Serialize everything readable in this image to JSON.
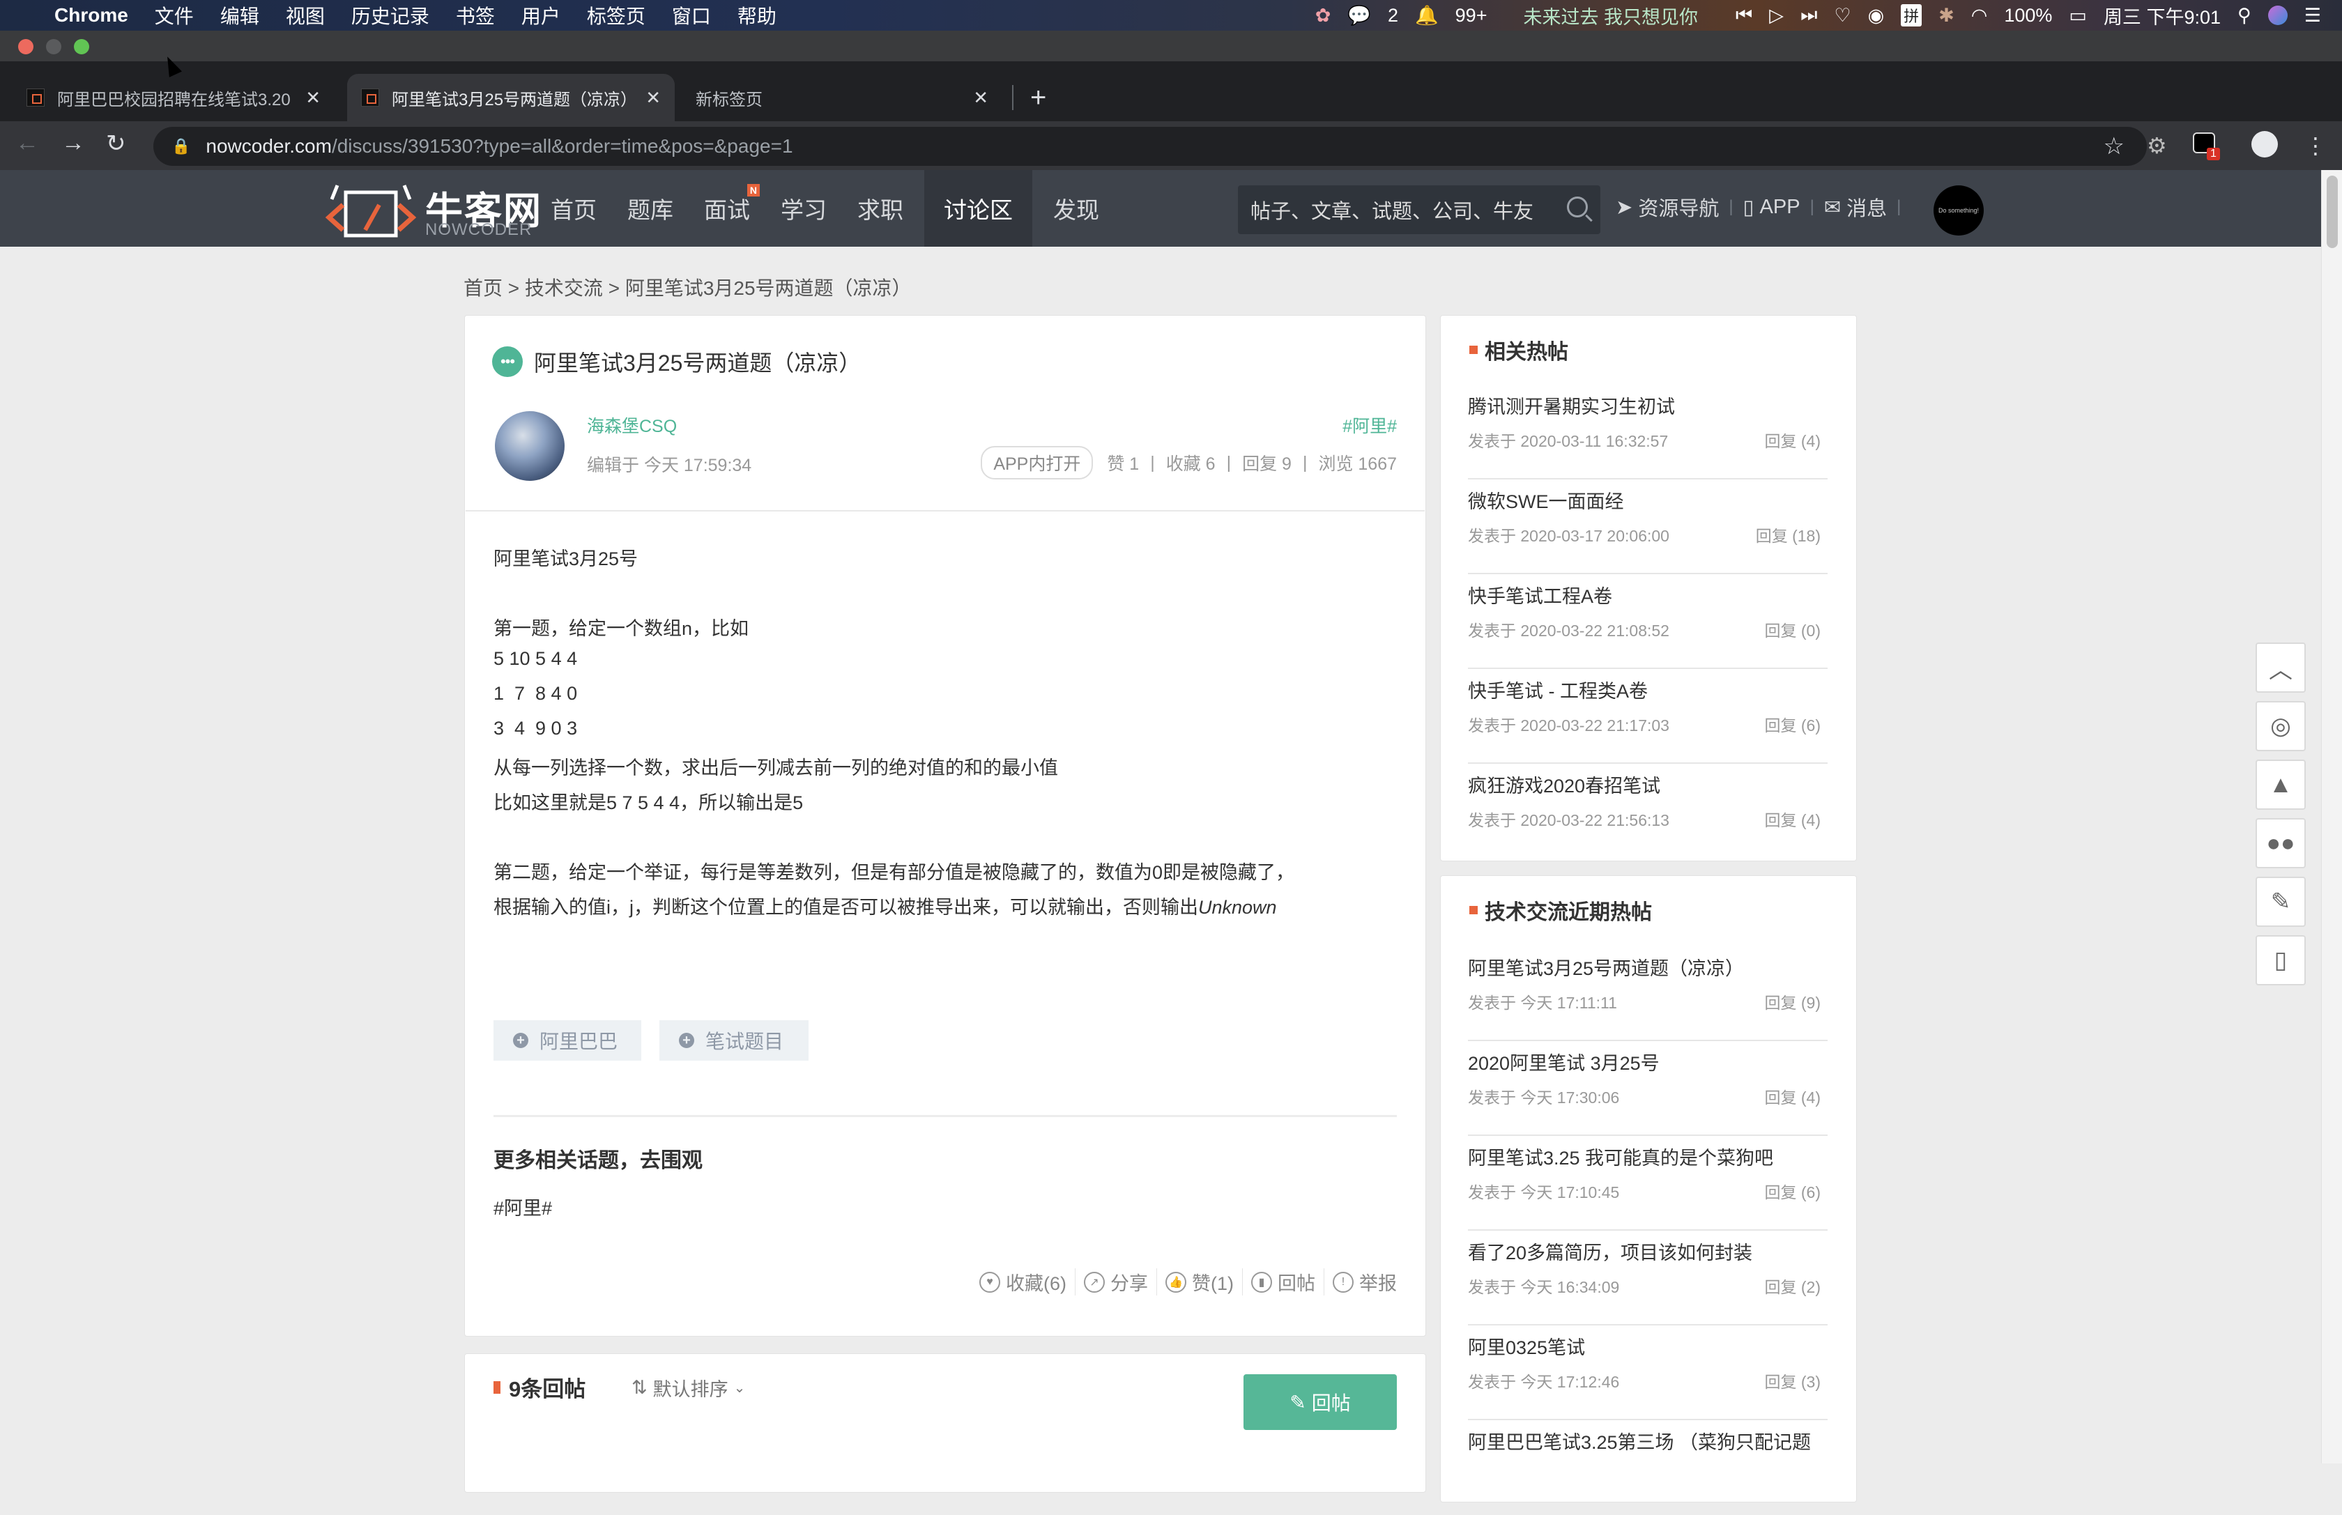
{
  "menubar": {
    "app": "Chrome",
    "items": [
      "文件",
      "编辑",
      "视图",
      "历史记录",
      "书签",
      "用户",
      "标签页",
      "窗口",
      "帮助"
    ],
    "wechat_count": "2",
    "qq_count": "99+",
    "now_playing": "未来过去 我只想见你",
    "ime": "拼",
    "battery": "100%",
    "clock": "周三 下午9:01"
  },
  "browser": {
    "tabs": [
      {
        "title": "阿里巴巴校园招聘在线笔试3.20",
        "active": false
      },
      {
        "title": "阿里笔试3月25号两道题（凉凉）",
        "active": true
      },
      {
        "title": "新标签页",
        "active": false
      }
    ],
    "url_host": "nowcoder.com",
    "url_path": "/discuss/391530?type=all&order=time&pos=&page=1",
    "extension_badge": "1"
  },
  "site": {
    "logo_cn": "牛客网",
    "logo_en": "NOWCODER",
    "nav": [
      {
        "label": "首页",
        "active": false
      },
      {
        "label": "题库",
        "active": false
      },
      {
        "label": "面试",
        "active": false,
        "badge": "N"
      },
      {
        "label": "学习",
        "active": false
      },
      {
        "label": "求职",
        "active": false
      },
      {
        "label": "讨论区",
        "active": true
      },
      {
        "label": "发现",
        "active": false
      }
    ],
    "search_placeholder": "帖子、文章、试题、公司、牛友",
    "links": {
      "resources": "资源导航",
      "app": "APP",
      "messages": "消息"
    },
    "user_avatar_text": "Do something!"
  },
  "breadcrumb": "首页 > 技术交流 > 阿里笔试3月25号两道题（凉凉）",
  "post": {
    "title": "阿里笔试3月25号两道题（凉凉）",
    "author": "海森堡CSQ",
    "edited": "编辑于 今天 17:59:34",
    "topic": "#阿里#",
    "open_in_app": "APP内打开",
    "stats": {
      "likes": "赞 1",
      "favorites": "收藏 6",
      "replies": "回复 9",
      "views": "浏览 1667"
    },
    "body": [
      "阿里笔试3月25号",
      "第一题，给定一个数组n，比如",
      "5 10 5 4 4",
      "1  7  8 4 0",
      "3  4  9 0 3",
      "从每一列选择一个数，求出后一列减去前一列的绝对值的和的最小值",
      "比如这里就是5 7 5 4 4，所以输出是5",
      "第二题，给定一个举证，每行是等差数列，但是有部分值是被隐藏了的，数值为0即是被隐藏了，",
      "根据输入的值i，j，判断这个位置上的值是否可以被推导出来，可以就输出，否则输出"
    ],
    "body_unknown": "Unknown",
    "tags": [
      "阿里巴巴",
      "笔试题目"
    ],
    "more_topics_title": "更多相关话题，去围观",
    "more_topics_tag": "#阿里#",
    "actions": [
      {
        "icon": "heart-icon",
        "label": "收藏(6)"
      },
      {
        "icon": "share-icon",
        "label": "分享"
      },
      {
        "icon": "thumbs-up-icon",
        "label": "赞(1)"
      },
      {
        "icon": "reply-icon",
        "label": "回帖"
      },
      {
        "icon": "report-icon",
        "label": "举报"
      }
    ]
  },
  "replies": {
    "count_label": "9条回帖",
    "sort_label": "默认排序",
    "reply_button": "回帖"
  },
  "sidebar": {
    "related": {
      "title": "相关热帖",
      "items": [
        {
          "title": "腾讯测开暑期实习生初试",
          "date": "发表于 2020-03-11 16:32:57",
          "replies": "回复 (4)"
        },
        {
          "title": "微软SWE一面面经",
          "date": "发表于 2020-03-17 20:06:00",
          "replies": "回复 (18)"
        },
        {
          "title": "快手笔试工程A卷",
          "date": "发表于 2020-03-22 21:08:52",
          "replies": "回复 (0)"
        },
        {
          "title": "快手笔试 - 工程类A卷",
          "date": "发表于 2020-03-22 21:17:03",
          "replies": "回复 (6)"
        },
        {
          "title": "疯狂游戏2020春招笔试",
          "date": "发表于 2020-03-22 21:56:13",
          "replies": "回复 (4)"
        }
      ]
    },
    "recent": {
      "title": "技术交流近期热帖",
      "items": [
        {
          "title": "阿里笔试3月25号两道题（凉凉）",
          "date": "发表于 今天 17:11:11",
          "replies": "回复 (9)"
        },
        {
          "title": "2020阿里笔试 3月25号",
          "date": "发表于 今天 17:30:06",
          "replies": "回复 (4)"
        },
        {
          "title": "阿里笔试3.25 我可能真的是个菜狗吧",
          "date": "发表于 今天 17:10:45",
          "replies": "回复 (6)"
        },
        {
          "title": "看了20多篇简历，项目该如何封装",
          "date": "发表于 今天 16:34:09",
          "replies": "回复 (2)"
        },
        {
          "title": "阿里0325笔试",
          "date": "发表于 今天 17:12:46",
          "replies": "回复 (3)"
        },
        {
          "title": "阿里巴巴笔试3.25第三场 （菜狗只配记题",
          "date": "",
          "replies": ""
        }
      ]
    }
  },
  "float_tools": [
    "back-to-top",
    "weibo",
    "qq",
    "wechat",
    "edit",
    "mobile"
  ],
  "colors": {
    "accent_green": "#56b797",
    "accent_orange": "#e8643c",
    "header_bg": "#3e434b"
  }
}
